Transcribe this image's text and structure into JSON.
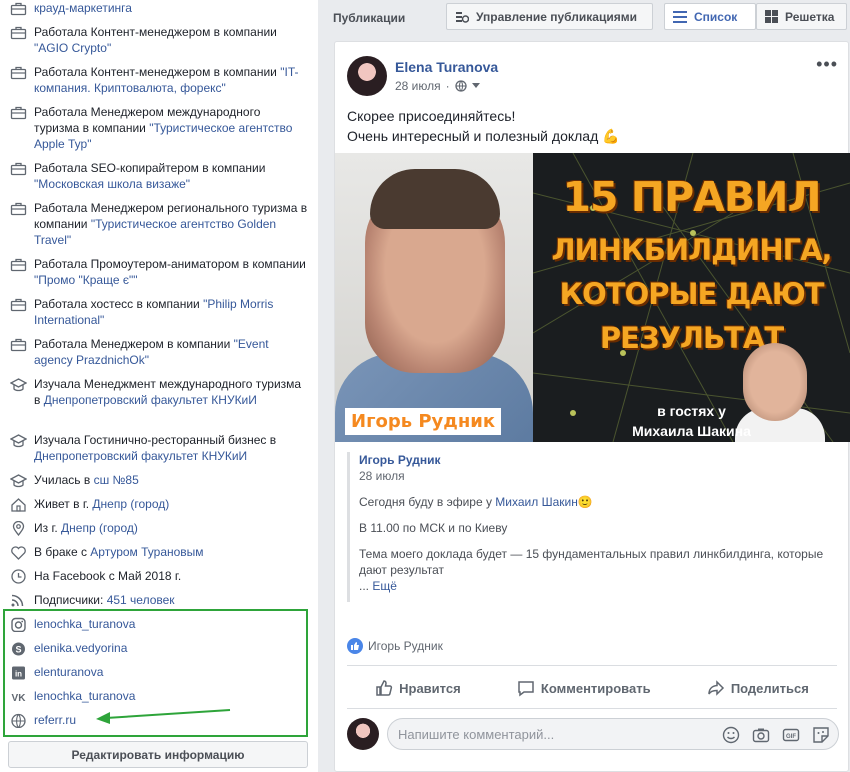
{
  "intro": {
    "rows": [
      {
        "icon": "briefcase-icon",
        "pre": "",
        "link": "крауд-маркетинга",
        "post": ""
      },
      {
        "icon": "briefcase-icon",
        "pre": "Работала Контент-менеджером в компании ",
        "link": "\"AGIO Crypto\"",
        "post": ""
      },
      {
        "icon": "briefcase-icon",
        "pre": "Работала Контент-менеджером в компании ",
        "link": "\"IT- компания. Криптовалюта, форекс\"",
        "post": ""
      },
      {
        "icon": "briefcase-icon",
        "pre": "Работала Менеджером международного туризма в компании ",
        "link": "\"Туристическое агентство Apple Тур\"",
        "post": ""
      },
      {
        "icon": "briefcase-icon",
        "pre": "Работала SEO-копирайтером в компании ",
        "link": "\"Московская школа визаже\"",
        "post": ""
      },
      {
        "icon": "briefcase-icon",
        "pre": "Работала Менеджером регионального туризма в компании ",
        "link": "\"Туристическое агентство Golden Travel\"",
        "post": ""
      },
      {
        "icon": "briefcase-icon",
        "pre": "Работала Промоутером-аниматором в компании ",
        "link": "\"Промо \"Краще є\"\"",
        "post": ""
      },
      {
        "icon": "briefcase-icon",
        "pre": "Работала хостесс в компании ",
        "link": "\"Philip Morris International\"",
        "post": ""
      },
      {
        "icon": "briefcase-icon",
        "pre": "Работала Менеджером в компании ",
        "link": "\"Event agency PrazdnichOk\"",
        "post": ""
      },
      {
        "icon": "graduation-cap-icon",
        "pre": "Изучала Менеджмент международного туризма в ",
        "link": "Днепропетровский факультет КНУКиИ",
        "post": ""
      },
      {
        "icon": "graduation-cap-icon",
        "pre": "Изучала Гостинично-ресторанный бизнес в ",
        "link": "Днепропетровский факультет КНУКиИ",
        "post": ""
      },
      {
        "icon": "graduation-cap-icon",
        "pre": "Училась в ",
        "link": "сш №85",
        "post": ""
      },
      {
        "icon": "home-icon",
        "pre": "Живет в г. ",
        "link": "Днепр (город)",
        "post": ""
      },
      {
        "icon": "location-pin-icon",
        "pre": "Из г. ",
        "link": "Днепр (город)",
        "post": ""
      },
      {
        "icon": "heart-icon",
        "pre": "В браке с ",
        "link": "Артуром Турановым",
        "post": ""
      },
      {
        "icon": "clock-icon",
        "pre": "На Facebook с Май 2018 г.",
        "link": "",
        "post": ""
      },
      {
        "icon": "rss-icon",
        "pre": "Подписчики: ",
        "link": "451 человек",
        "post": ""
      }
    ],
    "contacts": [
      {
        "icon": "instagram-icon",
        "text": "lenochka_turanova"
      },
      {
        "icon": "skype-icon",
        "text": "elenika.vedyorina"
      },
      {
        "icon": "linkedin-icon",
        "text": "elenturanova"
      },
      {
        "icon": "vk-icon",
        "text": "lenochka_turanova"
      },
      {
        "icon": "globe-icon",
        "text": "referr.ru"
      }
    ],
    "edit_label": "Редактировать информацию",
    "highlight_color": "#2ea43a"
  },
  "header": {
    "title": "Публикации",
    "manage_label": "Управление публикациями",
    "list_label": "Список",
    "grid_label": "Решетка"
  },
  "post": {
    "author": "Elena Turanova",
    "date": "28 июля",
    "text_line1": "Скорее присоединяйтесь!",
    "text_line2": "Очень интересный и полезный доклад 💪",
    "image": {
      "title1": "15 ПРАВИЛ",
      "title2": "ЛИНКБИЛДИНГА,",
      "title3": "КОТОРЫЕ ДАЮТ",
      "title4": "РЕЗУЛЬТАТ",
      "name_badge": "Игорь Рудник",
      "guest_line1": "в гостях у",
      "guest_line2": "Михаила Шакина"
    },
    "shared": {
      "author": "Игорь Рудник",
      "date": "28 июля",
      "p1_pre": "Сегодня буду в эфире у ",
      "p1_link": "Михаил Шакин",
      "p1_emoji": "🙂",
      "p2": "В 11.00 по МСК и по Киеву",
      "p3": "Тема моего доклада будет — 15 фундаментальных правил линкбилдинга, которые дают результат",
      "ellipsis": "...",
      "more": "Ещё"
    },
    "reactions": "Игорь Рудник",
    "actions": {
      "like": "Нравится",
      "comment": "Комментировать",
      "share": "Поделиться"
    },
    "comment_placeholder": "Напишите комментарий..."
  },
  "colors": {
    "link": "#365899",
    "accent": "#4267b2",
    "title_orange": "#f5a623"
  }
}
